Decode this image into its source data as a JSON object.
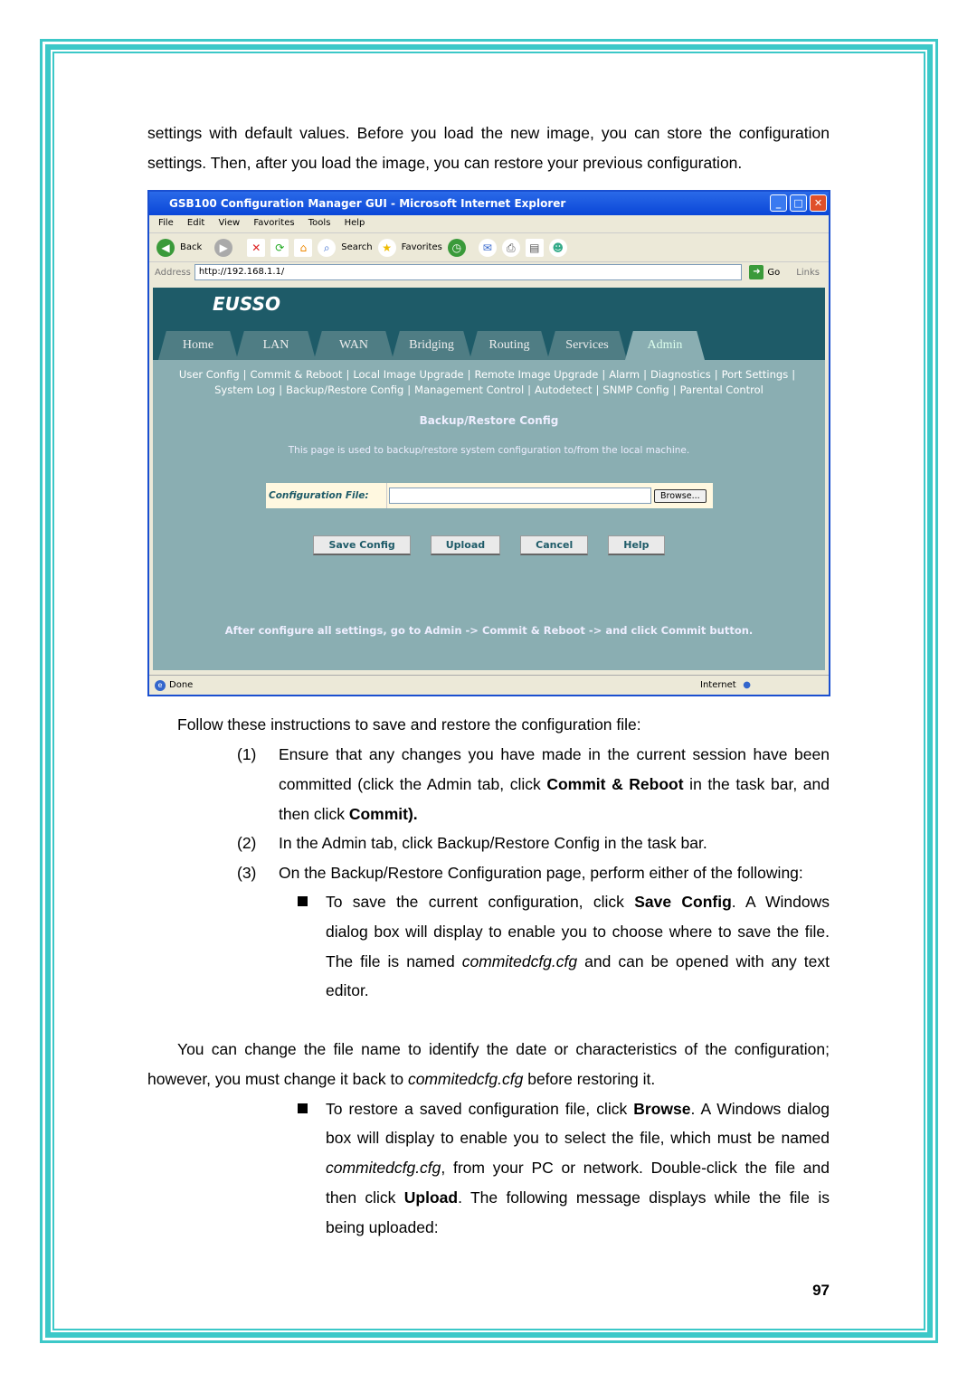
{
  "intro": [
    "settings with default values. Before you load the new image, you can store the configuration",
    "settings. Then, after you load the image, you can restore your previous configuration."
  ],
  "browser": {
    "title": "GSB100 Configuration Manager GUI - Microsoft Internet Explorer",
    "menu": [
      "File",
      "Edit",
      "View",
      "Favorites",
      "Tools",
      "Help"
    ],
    "toolbar": {
      "back": "Back",
      "search": "Search",
      "favorites": "Favorites"
    },
    "address_label": "Address",
    "url": "http://192.168.1.1/",
    "go": "Go",
    "links": "Links",
    "status": "Done",
    "zone": "Internet"
  },
  "app": {
    "logo": "EUSSO",
    "tabs": [
      "Home",
      "LAN",
      "WAN",
      "Bridging",
      "Routing",
      "Services",
      "Admin"
    ],
    "active_tab": "Admin",
    "subnav1": [
      "User Config",
      "Commit & Reboot",
      "Local Image Upgrade",
      "Remote Image Upgrade",
      "Alarm",
      "Diagnostics",
      "Port Settings"
    ],
    "subnav2": [
      "System Log",
      "Backup/Restore Config",
      "Management Control",
      "Autodetect",
      "SNMP Config",
      "Parental Control"
    ],
    "heading": "Backup/Restore Config",
    "description": "This page is used to backup/restore system configuration to/from the local machine.",
    "field_label": "Configuration File:",
    "browse": "Browse...",
    "buttons": [
      "Save Config",
      "Upload",
      "Cancel",
      "Help"
    ],
    "footer_note": "After configure all settings, go to Admin -> Commit & Reboot -> and click Commit button."
  },
  "instructions_lead": "Follow these instructions to save and restore the configuration file:",
  "steps": [
    {
      "num": "(1)",
      "l1": "Ensure that any changes you have made in the current session have been",
      "l2a": "committed (click the Admin tab, click ",
      "l2b": "Commit & Reboot",
      "l2c": " in the task bar, and",
      "l3a": "then click ",
      "l3b": "Commit)."
    },
    {
      "num": "(2)",
      "text": "In the Admin tab, click Backup/Restore Config in the task bar."
    },
    {
      "num": "(3)",
      "text": "On the Backup/Restore Configuration page, perform either of the following:"
    }
  ],
  "bullet1": {
    "a": "To save the current configuration, click ",
    "b": "Save Config",
    "c": ". A Windows",
    "l2": "dialog box will display to enable you to choose where to save the file.",
    "l3a": "The file is named ",
    "l3b": "commitedcfg.cfg",
    "l3c": " and can be opened with any text",
    "l4": "editor."
  },
  "para": {
    "l1": "You can change the file name to identify the date or characteristics of the configuration;",
    "l2a": "however, you must change it back to ",
    "l2b": "commitedcfg.cfg",
    "l2c": " before restoring it."
  },
  "bullet2": {
    "a": "To restore a saved configuration file, click ",
    "b": "Browse",
    "c": ". A Windows dialog",
    "l2": "box will display to enable you to select the file, which must be named",
    "l3a": "commitedcfg.cfg",
    "l3b": ", from your PC or network. Double-click the file and",
    "l4a": "then click ",
    "l4b": "Upload",
    "l4c": ". The following message displays while the file is",
    "l5": "being uploaded:"
  },
  "page_number": "97",
  "colors": {
    "border": "#3cc8c8",
    "app_header": "#1e5b68",
    "app_body": "#8aaeb2"
  }
}
